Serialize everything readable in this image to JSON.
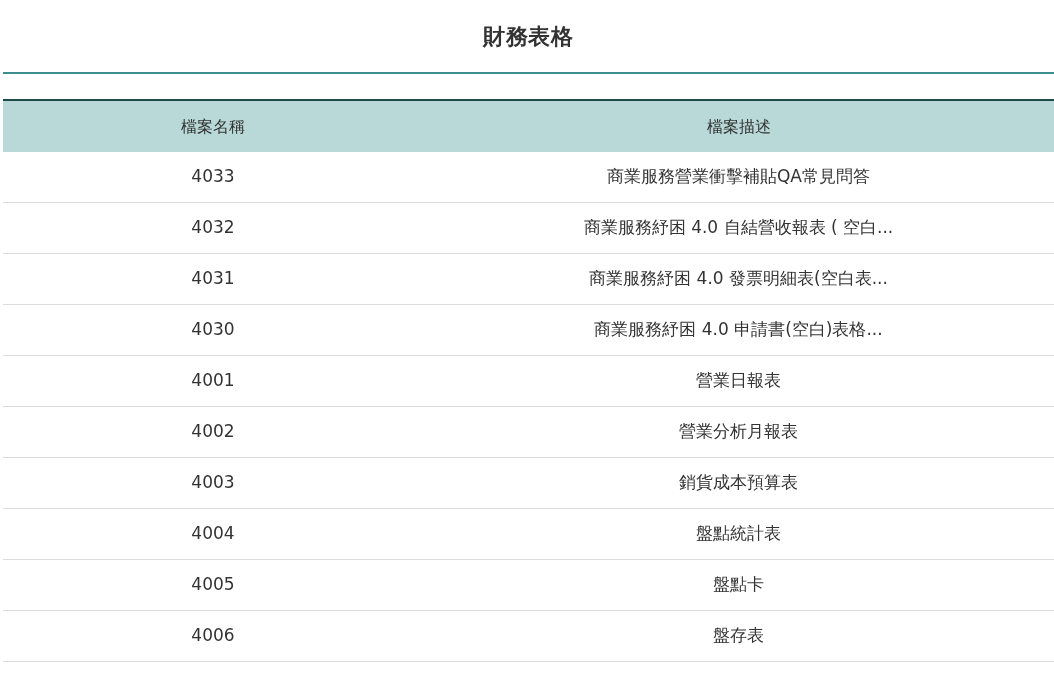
{
  "title": "財務表格",
  "table": {
    "columns": [
      "檔案名稱",
      "檔案描述"
    ],
    "rows": [
      {
        "name": "4033",
        "description": "商業服務營業衝擊補貼QA常見問答"
      },
      {
        "name": "4032",
        "description": "商業服務紓困 4.0 自結營收報表 ( 空白..."
      },
      {
        "name": "4031",
        "description": "商業服務紓困 4.0 發票明細表(空白表..."
      },
      {
        "name": "4030",
        "description": "商業服務紓困 4.0 申請書(空白)表格..."
      },
      {
        "name": "4001",
        "description": "營業日報表"
      },
      {
        "name": "4002",
        "description": "營業分析月報表"
      },
      {
        "name": "4003",
        "description": "銷貨成本預算表"
      },
      {
        "name": "4004",
        "description": "盤點統計表"
      },
      {
        "name": "4005",
        "description": "盤點卡"
      },
      {
        "name": "4006",
        "description": "盤存表"
      }
    ]
  }
}
